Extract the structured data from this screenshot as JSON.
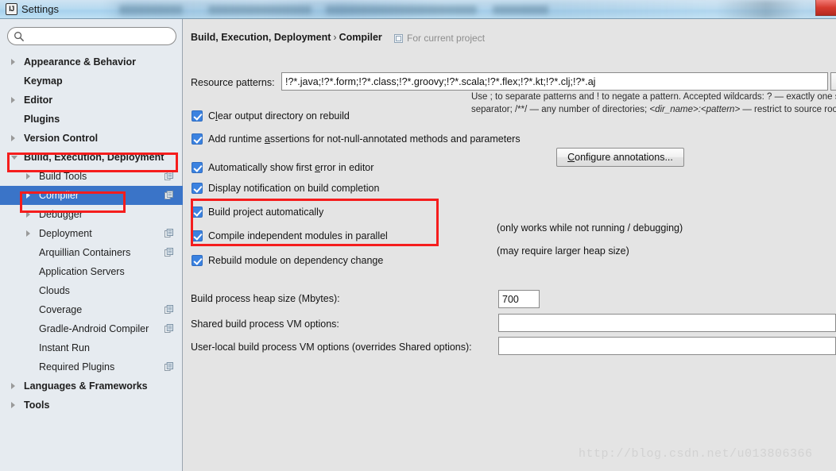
{
  "window": {
    "app_icon": "IJ",
    "title": "Settings",
    "close_icon": "close-icon"
  },
  "sidebar": {
    "search": {
      "value": "",
      "placeholder": "",
      "icon": "search-icon"
    },
    "items": [
      {
        "label": "Appearance & Behavior",
        "level": 0,
        "bold": true,
        "arrow": "right",
        "copy": false
      },
      {
        "label": "Keymap",
        "level": 0,
        "bold": true,
        "arrow": "none",
        "copy": false
      },
      {
        "label": "Editor",
        "level": 0,
        "bold": true,
        "arrow": "right",
        "copy": false
      },
      {
        "label": "Plugins",
        "level": 0,
        "bold": true,
        "arrow": "none",
        "copy": false
      },
      {
        "label": "Version Control",
        "level": 0,
        "bold": true,
        "arrow": "right",
        "copy": false
      },
      {
        "label": "Build, Execution, Deployment",
        "level": 0,
        "bold": true,
        "arrow": "down",
        "copy": false
      },
      {
        "label": "Build Tools",
        "level": 1,
        "bold": false,
        "arrow": "right",
        "copy": true
      },
      {
        "label": "Compiler",
        "level": 1,
        "bold": false,
        "arrow": "right",
        "copy": true,
        "selected": true
      },
      {
        "label": "Debugger",
        "level": 1,
        "bold": false,
        "arrow": "right",
        "copy": false
      },
      {
        "label": "Deployment",
        "level": 1,
        "bold": false,
        "arrow": "right",
        "copy": true
      },
      {
        "label": "Arquillian Containers",
        "level": 1,
        "bold": false,
        "arrow": "none",
        "copy": true
      },
      {
        "label": "Application Servers",
        "level": 1,
        "bold": false,
        "arrow": "none",
        "copy": false
      },
      {
        "label": "Clouds",
        "level": 1,
        "bold": false,
        "arrow": "none",
        "copy": false
      },
      {
        "label": "Coverage",
        "level": 1,
        "bold": false,
        "arrow": "none",
        "copy": true
      },
      {
        "label": "Gradle-Android Compiler",
        "level": 1,
        "bold": false,
        "arrow": "none",
        "copy": true
      },
      {
        "label": "Instant Run",
        "level": 1,
        "bold": false,
        "arrow": "none",
        "copy": false
      },
      {
        "label": "Required Plugins",
        "level": 1,
        "bold": false,
        "arrow": "none",
        "copy": true
      },
      {
        "label": "Languages & Frameworks",
        "level": 0,
        "bold": true,
        "arrow": "right",
        "copy": false
      },
      {
        "label": "Tools",
        "level": 0,
        "bold": true,
        "arrow": "right",
        "copy": false
      }
    ]
  },
  "main": {
    "breadcrumb": {
      "parent": "Build, Execution, Deployment",
      "separator": "›",
      "current": "Compiler"
    },
    "scope_note": "For current project",
    "scope_icon": "project-scope-icon",
    "resource_patterns": {
      "label": "Resource patterns:",
      "value": "!?*.java;!?*.form;!?*.class;!?*.groovy;!?*.scala;!?*.flex;!?*.kt;!?*.clj;!?*.aj"
    },
    "hint_line1": "Use ; to separate patterns and ! to negate a pattern. Accepted wildcards: ? — exactly one symbol; * — zero or more symbols; / — pa",
    "hint_line2_pre": "separator; /**/ — any number of directories;  ",
    "hint_line2_ital": "<dir_name>:<pattern>",
    "hint_line2_post": " — restrict to source roots with the specified name",
    "checkboxes": [
      {
        "id": "clear-output-directory",
        "pre": "C",
        "mnemonic": "l",
        "post": "ear output directory on rebuild",
        "checked": true
      },
      {
        "id": "add-runtime-assertions",
        "pre": "Add runtime ",
        "mnemonic": "a",
        "post": "ssertions for not-null-annotated methods and parameters",
        "checked": true
      },
      {
        "id": "show-first-error",
        "pre": "Automatically show first ",
        "mnemonic": "e",
        "post": "rror in editor",
        "checked": true
      },
      {
        "id": "display-notification",
        "pre": "Display notification on build completion",
        "mnemonic": "",
        "post": "",
        "checked": true
      },
      {
        "id": "build-project-automatically",
        "pre": "Build project automatically",
        "mnemonic": "",
        "post": "",
        "checked": true
      },
      {
        "id": "compile-independent-modules",
        "pre": "Compile independent modules in parallel",
        "mnemonic": "",
        "post": "",
        "checked": true
      },
      {
        "id": "rebuild-module-on-dependency-change",
        "pre": "Rebuild module on dependency change",
        "mnemonic": "",
        "post": "",
        "checked": true
      }
    ],
    "configure_annotations_button": {
      "pre": "C",
      "mnemonic": "",
      "label": "Configure annotations..."
    },
    "note_build_auto": "(only works while not running / debugging)",
    "note_parallel": "(may require larger heap size)",
    "heap": {
      "label": "Build process heap size (Mbytes):",
      "value": "700"
    },
    "shared_vm": {
      "label": "Shared build process VM options:",
      "value": ""
    },
    "user_vm": {
      "label": "User-local build process VM options (overrides Shared options):",
      "value": ""
    }
  },
  "watermark": "http://blog.csdn.net/u013806366",
  "colors": {
    "selection_blue": "#3a74c8",
    "checkbox_blue": "#3b82e0",
    "annotation_red": "#f51d1d",
    "sidebar_bg": "#e6ebf0",
    "main_bg": "#e4e4e4"
  }
}
